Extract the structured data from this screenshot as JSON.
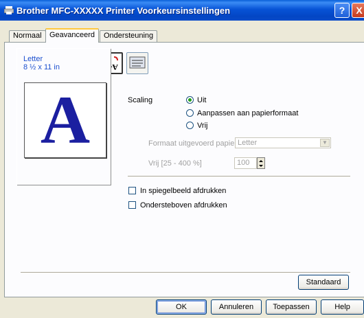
{
  "window": {
    "title": "Brother MFC-XXXXX Printer Voorkeursinstellingen",
    "help_glyph": "?",
    "close_glyph": "X"
  },
  "tabs": [
    {
      "label": "Normaal",
      "active": false
    },
    {
      "label": "Geavanceerd",
      "active": true
    },
    {
      "label": "Ondersteuning",
      "active": false
    }
  ],
  "toolbar_icons": [
    {
      "name": "color-quality-icon",
      "selected": false
    },
    {
      "name": "n-up-layout-icon",
      "glyph": "A|B",
      "selected": false
    },
    {
      "name": "watermark-icon",
      "selected": false
    },
    {
      "name": "page-setting-icon",
      "selected": true
    },
    {
      "name": "device-options-icon",
      "selected": false
    }
  ],
  "preview": {
    "paper_name": "Letter",
    "paper_size": "8 ½ x 11 in",
    "letter": "A"
  },
  "scaling": {
    "label": "Scaling",
    "options": [
      {
        "label": "Uit",
        "checked": true
      },
      {
        "label": "Aanpassen aan papierformaat",
        "checked": false
      },
      {
        "label": "Vrij",
        "checked": false
      }
    ],
    "output_paper_label": "Formaat uitgevoerd papier",
    "output_paper_value": "Letter",
    "free_label": "Vrij [25 - 400 %]",
    "free_value": "100"
  },
  "options": [
    {
      "label": "In spiegelbeeld afdrukken",
      "checked": false
    },
    {
      "label": "Ondersteboven afdrukken",
      "checked": false
    }
  ],
  "buttons": {
    "default": "Standaard",
    "ok": "OK",
    "cancel": "Annuleren",
    "apply": "Toepassen",
    "help": "Help"
  },
  "colors": {
    "titlebar": "#0753d6",
    "accent_tab": "#ffc83c",
    "preview_letter": "#1b1fa0"
  }
}
